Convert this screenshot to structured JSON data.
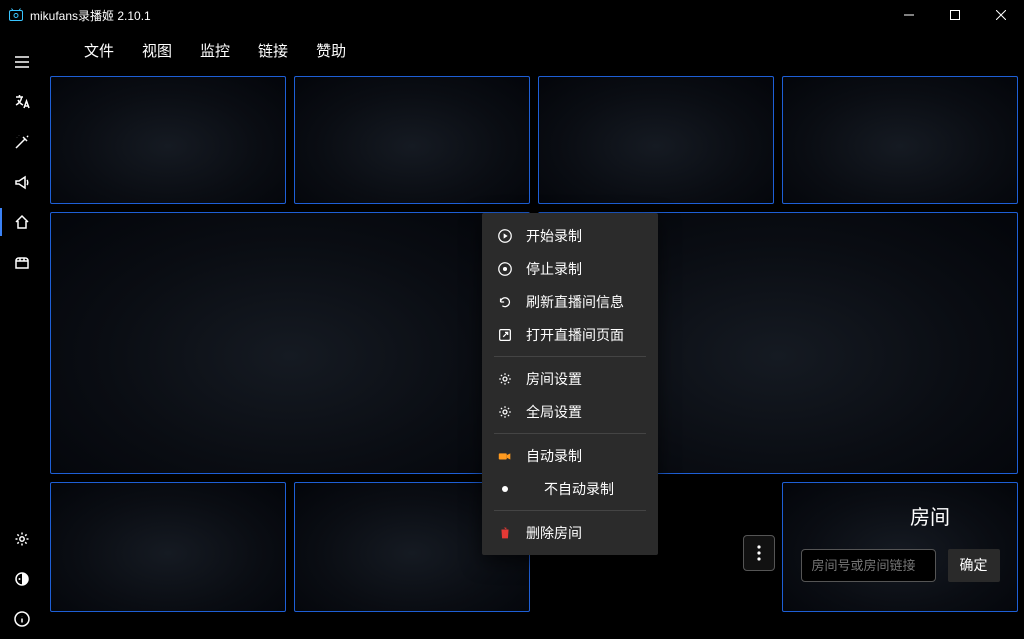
{
  "window": {
    "title": "mikufans录播姬 2.10.1"
  },
  "menubar": {
    "items": [
      "文件",
      "视图",
      "监控",
      "链接",
      "赞助"
    ]
  },
  "sidebar": {
    "top_icons": [
      "menu-icon",
      "translate-icon",
      "magic-icon",
      "megaphone-icon",
      "home-icon",
      "toolbox-icon"
    ],
    "bottom_icons": [
      "gear-icon",
      "theme-icon",
      "info-icon"
    ],
    "active_index": 4
  },
  "context_menu": {
    "items": [
      {
        "label": "开始录制",
        "icon": "play-circle-icon"
      },
      {
        "label": "停止录制",
        "icon": "stop-circle-icon"
      },
      {
        "label": "刷新直播间信息",
        "icon": "refresh-icon"
      },
      {
        "label": "打开直播间页面",
        "icon": "external-link-icon"
      },
      {
        "sep": true
      },
      {
        "label": "房间设置",
        "icon": "gear-icon"
      },
      {
        "label": "全局设置",
        "icon": "gear-icon"
      },
      {
        "sep": true
      },
      {
        "label": "自动录制",
        "icon": "camera-icon",
        "orange": true
      },
      {
        "label": "不自动录制",
        "radio": true
      },
      {
        "sep": true
      },
      {
        "label": "删除房间",
        "icon": "trash-icon",
        "red": true
      }
    ]
  },
  "addroom": {
    "visible_partial_title": "房间",
    "placeholder": "房间号或房间链接",
    "ok_label": "确定"
  }
}
